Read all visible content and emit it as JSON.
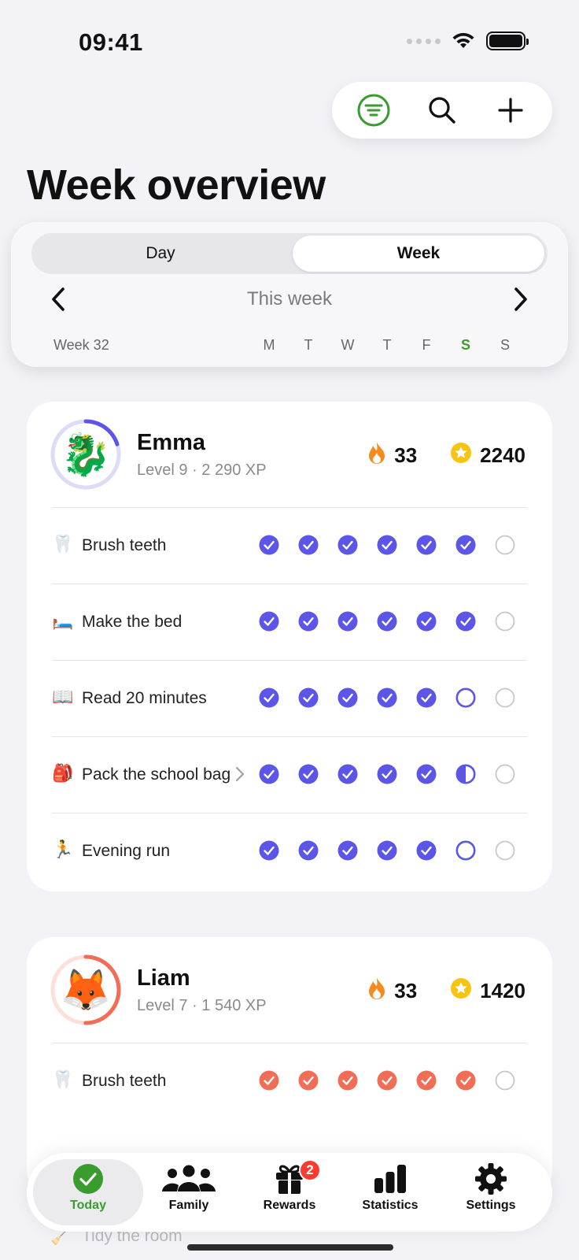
{
  "status_bar": {
    "time": "09:41"
  },
  "header": {
    "title": "Week overview"
  },
  "view_switch": {
    "day_label": "Day",
    "week_label": "Week",
    "selected": "Week"
  },
  "week_nav": {
    "period_label": "This week",
    "week_number": "Week 32",
    "days": [
      "M",
      "T",
      "W",
      "T",
      "F",
      "S",
      "S"
    ],
    "today_index": 5
  },
  "colors": {
    "accent_green": "#3a9b2e",
    "emma_color": "#5b55e8",
    "liam_color": "#f26d55",
    "streak": "#f58a1f",
    "coin": "#f7c511"
  },
  "members": [
    {
      "name": "Emma",
      "level": "Level 9 · 2 290 XP",
      "avatar": "🐉",
      "avatar_icon": "dragon-icon",
      "level_progress": 0.2,
      "streak": "33",
      "coins": "2240",
      "color": "#5b55e8",
      "tasks": [
        {
          "emoji": "🦷",
          "label": "Brush teeth",
          "days": [
            "done",
            "done",
            "done",
            "done",
            "done",
            "done",
            "future"
          ]
        },
        {
          "emoji": "🛏️",
          "label": "Make the bed",
          "days": [
            "done",
            "done",
            "done",
            "done",
            "done",
            "done",
            "future"
          ]
        },
        {
          "emoji": "📖",
          "label": "Read 20 minutes",
          "days": [
            "done",
            "done",
            "done",
            "done",
            "done",
            "open",
            "future"
          ]
        },
        {
          "emoji": "🎒",
          "label": "Pack the school bag",
          "has_chevron": true,
          "days": [
            "done",
            "done",
            "done",
            "done",
            "done",
            "half",
            "future"
          ]
        },
        {
          "emoji": "🏃",
          "label": "Evening run",
          "days": [
            "done",
            "done",
            "done",
            "done",
            "done",
            "open",
            "future"
          ]
        }
      ]
    },
    {
      "name": "Liam",
      "level": "Level 7 · 1 540 XP",
      "avatar": "🦊",
      "avatar_icon": "fox-icon",
      "level_progress": 0.5,
      "streak": "33",
      "coins": "1420",
      "color": "#f26d55",
      "tasks": [
        {
          "emoji": "🦷",
          "label": "Brush teeth",
          "days": [
            "done",
            "done",
            "done",
            "done",
            "done",
            "done",
            "future"
          ]
        }
      ]
    }
  ],
  "hidden_row": {
    "label": "Tidy the room"
  },
  "tabbar": {
    "items": [
      {
        "label": "Today",
        "icon": "checkmark-circle-icon",
        "active": true
      },
      {
        "label": "Family",
        "icon": "people-icon"
      },
      {
        "label": "Rewards",
        "icon": "gift-icon",
        "badge": "2"
      },
      {
        "label": "Statistics",
        "icon": "bar-chart-icon"
      },
      {
        "label": "Settings",
        "icon": "gear-icon"
      }
    ]
  }
}
